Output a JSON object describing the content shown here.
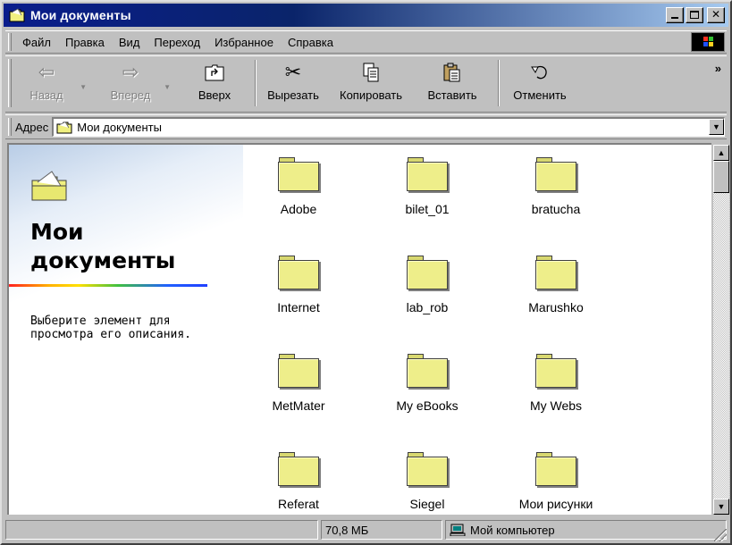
{
  "window": {
    "title": "Мои документы"
  },
  "menu": [
    "Файл",
    "Правка",
    "Вид",
    "Переход",
    "Избранное",
    "Справка"
  ],
  "toolbar": {
    "back": "Назад",
    "forward": "Вперед",
    "up": "Вверх",
    "cut": "Вырезать",
    "copy": "Копировать",
    "paste": "Вставить",
    "undo": "Отменить"
  },
  "address": {
    "label": "Адрес",
    "value": "Мои документы"
  },
  "left_pane": {
    "title_line1": "Мои",
    "title_line2": "документы",
    "description": "Выберите элемент для просмотра его описания."
  },
  "folders": [
    "Adobe",
    "bilet_01",
    "bratucha",
    "Internet",
    "lab_rob",
    "Marushko",
    "MetMater",
    "My eBooks",
    "My Webs",
    "Referat",
    "Siegel",
    "Мои рисунки"
  ],
  "status": {
    "size": "70,8 МБ",
    "location": "Мой компьютер"
  },
  "colors": {
    "title_bar": "#0a246a",
    "folder": "#eeee8a",
    "face": "#c0c0c0"
  }
}
